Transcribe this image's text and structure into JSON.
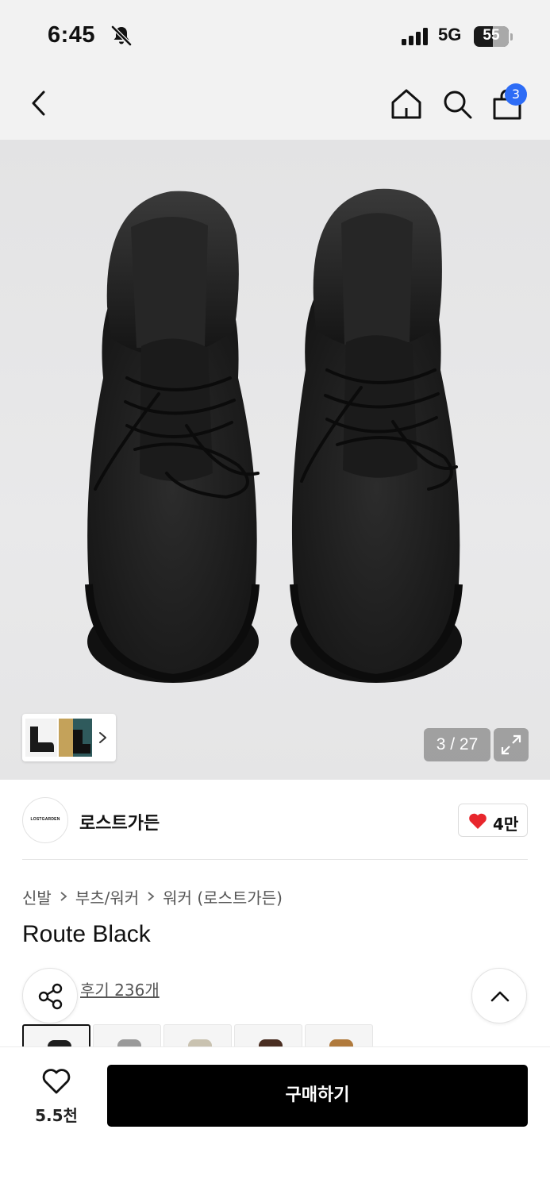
{
  "status_bar": {
    "time": "6:45",
    "network": "5G",
    "battery_level": "55"
  },
  "nav": {
    "cart_count": "3",
    "icons": [
      "back-chevron-icon",
      "home-icon",
      "search-icon",
      "shopping-bag-icon"
    ]
  },
  "gallery": {
    "page_counter": "3 / 27",
    "current_page": 3,
    "total_pages": 27
  },
  "brand": {
    "logo_text": "LOSTGARDEN",
    "name": "로스트가든",
    "likes": "4만"
  },
  "breadcrumb": {
    "items": [
      "신발",
      "부츠/워커",
      "워커 (로스트가든)"
    ]
  },
  "product": {
    "title": "Route Black",
    "reviews_label": "후기 236개"
  },
  "colors": {
    "heart": "#e8262c",
    "badge": "#2d6cf6",
    "buy_button": "#000000"
  },
  "bottom_bar": {
    "wish_count": "5.5천",
    "buy_label": "구매하기"
  }
}
